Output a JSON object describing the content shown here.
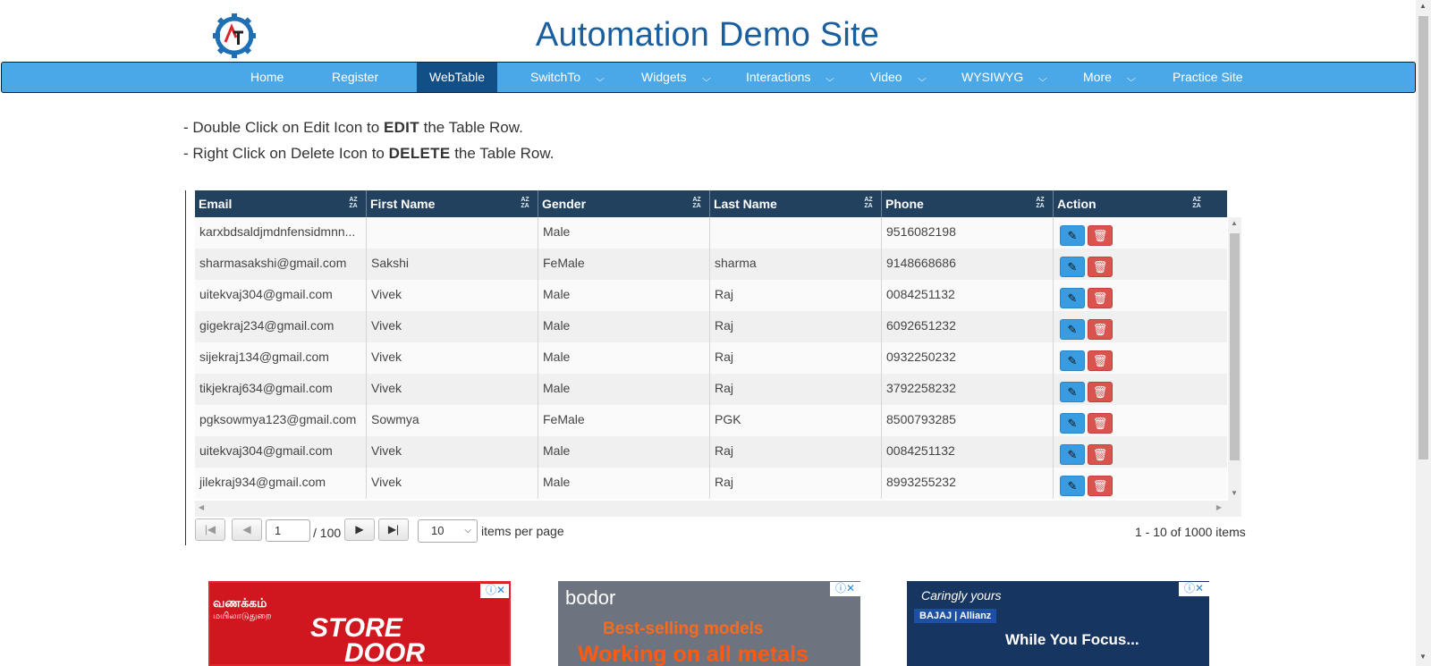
{
  "header": {
    "title": "Automation Demo Site"
  },
  "nav": {
    "items": [
      {
        "label": "Home",
        "dropdown": false
      },
      {
        "label": "Register",
        "dropdown": false
      },
      {
        "label": "WebTable",
        "dropdown": false,
        "active": true
      },
      {
        "label": "SwitchTo",
        "dropdown": true
      },
      {
        "label": "Widgets",
        "dropdown": true
      },
      {
        "label": "Interactions",
        "dropdown": true
      },
      {
        "label": "Video",
        "dropdown": true
      },
      {
        "label": "WYSIWYG",
        "dropdown": true
      },
      {
        "label": "More",
        "dropdown": true
      },
      {
        "label": "Practice Site",
        "dropdown": false
      }
    ]
  },
  "instructions": {
    "line1_pre": "- Double Click on Edit Icon to ",
    "line1_bold": "EDIT",
    "line1_post": " the Table Row.",
    "line2_pre": "- Right Click on Delete Icon to ",
    "line2_bold": "DELETE",
    "line2_post": " the Table Row."
  },
  "table": {
    "columns": [
      "Email",
      "First Name",
      "Gender",
      "Last Name",
      "Phone",
      "Action"
    ],
    "rows": [
      [
        "karxbdsaldjmdnfensidmnn...",
        "",
        "Male",
        "",
        "9516082198"
      ],
      [
        "sharmasakshi@gmail.com",
        "Sakshi",
        "FeMale",
        "sharma",
        "9148668686"
      ],
      [
        "uitekvaj304@gmail.com",
        "Vivek",
        "Male",
        "Raj",
        "0084251132"
      ],
      [
        "gigekraj234@gmail.com",
        "Vivek",
        "Male",
        "Raj",
        "6092651232"
      ],
      [
        "sijekraj134@gmail.com",
        "Vivek",
        "Male",
        "Raj",
        "0932250232"
      ],
      [
        "tikjekraj634@gmail.com",
        "Vivek",
        "Male",
        "Raj",
        "3792258232"
      ],
      [
        "pgksowmya123@gmail.com",
        "Sowmya",
        "FeMale",
        "PGK",
        "8500793285"
      ],
      [
        "uitekvaj304@gmail.com",
        "Vivek",
        "Male",
        "Raj",
        "0084251132"
      ],
      [
        "jilekraj934@gmail.com",
        "Vivek",
        "Male",
        "Raj",
        "8993255232"
      ]
    ],
    "edit_icon": "pencil-icon",
    "delete_icon": "trash-icon",
    "sort_icon": "sort-alpha-icon"
  },
  "pager": {
    "current_page": "1",
    "total_pages": "/ 100",
    "page_size": "10",
    "items_per_page_label": "items per page",
    "summary": "1 - 10 of 1000 items"
  },
  "ads": {
    "ad1_text1": "வணக்கம்",
    "ad1_text2": "மயிலாடுதுறை",
    "ad1_text3": "STORE",
    "ad1_text4": "DOOR",
    "ad2_text1": "bodor",
    "ad2_text2": "Best-selling models",
    "ad2_text3": "Working on all metals",
    "ad3_text1": "Caringly yours",
    "ad3_text2": "BAJAJ | Allianz",
    "ad3_text3": "While You Focus..."
  },
  "colors": {
    "nav_bg": "#4aa8e8",
    "nav_active": "#134f87",
    "table_header": "#22415f",
    "title": "#1a5e9e",
    "edit_btn": "#3a9ce0",
    "delete_btn": "#d9534f"
  }
}
